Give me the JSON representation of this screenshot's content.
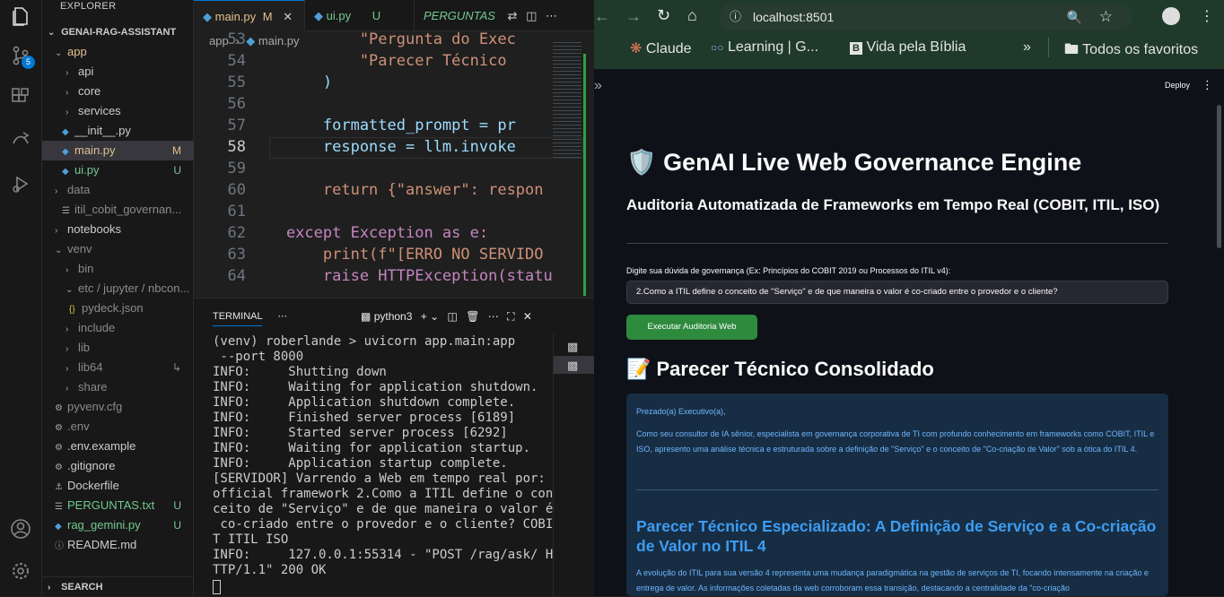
{
  "vscode": {
    "activity": {
      "source_control_badge": "5"
    },
    "explorer": {
      "header": "EXPLORER",
      "root": "GENAI-RAG-ASSISTANT",
      "items": [
        {
          "label": "app",
          "badge": ""
        },
        {
          "label": "api",
          "badge": ""
        },
        {
          "label": "core",
          "badge": ""
        },
        {
          "label": "services",
          "badge": ""
        },
        {
          "label": "__init__.py",
          "badge": ""
        },
        {
          "label": "main.py",
          "badge": "M"
        },
        {
          "label": "ui.py",
          "badge": "U"
        },
        {
          "label": "data",
          "badge": ""
        },
        {
          "label": "itil_cobit_governan...",
          "badge": ""
        },
        {
          "label": "notebooks",
          "badge": ""
        },
        {
          "label": "venv",
          "badge": ""
        },
        {
          "label": "bin",
          "badge": ""
        },
        {
          "label": "etc / jupyter / nbcon...",
          "badge": ""
        },
        {
          "label": "pydeck.json",
          "badge": ""
        },
        {
          "label": "include",
          "badge": ""
        },
        {
          "label": "lib",
          "badge": ""
        },
        {
          "label": "lib64",
          "badge": "↳"
        },
        {
          "label": "share",
          "badge": ""
        },
        {
          "label": "pyvenv.cfg",
          "badge": ""
        },
        {
          "label": ".env",
          "badge": ""
        },
        {
          "label": ".env.example",
          "badge": ""
        },
        {
          "label": ".gitignore",
          "badge": ""
        },
        {
          "label": "Dockerfile",
          "badge": ""
        },
        {
          "label": "PERGUNTAS.txt",
          "badge": "U"
        },
        {
          "label": "rag_gemini.py",
          "badge": "U"
        },
        {
          "label": "README.md",
          "badge": ""
        }
      ],
      "search_section": "SEARCH"
    },
    "tabs": [
      {
        "label": "main.py",
        "badge": "M"
      },
      {
        "label": "ui.py",
        "badge": "U"
      },
      {
        "label": "PERGUNTAS",
        "badge": ""
      }
    ],
    "breadcrumb": [
      "app",
      "main.py"
    ],
    "code": [
      {
        "n": "53",
        "text": "            \"Pergunta do Exec"
      },
      {
        "n": "54",
        "text": "            \"Parecer Técnico "
      },
      {
        "n": "55",
        "text": "        )"
      },
      {
        "n": "56",
        "text": ""
      },
      {
        "n": "57",
        "text": "        formatted_prompt = pr"
      },
      {
        "n": "58",
        "text": "        response = llm.invoke"
      },
      {
        "n": "59",
        "text": ""
      },
      {
        "n": "60",
        "text": "        return {\"answer\": respon"
      },
      {
        "n": "61",
        "text": ""
      },
      {
        "n": "62",
        "text": "    except Exception as e:"
      },
      {
        "n": "63",
        "text": "        print(f\"[ERRO NO SERVIDO"
      },
      {
        "n": "64",
        "text": "        raise HTTPException(statu"
      }
    ],
    "terminal": {
      "tab": "TERMINAL",
      "shell": "python3",
      "lines": [
        "(venv) roberlande > uvicorn app.main:app",
        " --port 8000",
        "INFO:     Shutting down",
        "INFO:     Waiting for application shutdown.",
        "INFO:     Application shutdown complete.",
        "INFO:     Finished server process [6189]",
        "INFO:     Started server process [6292]",
        "INFO:     Waiting for application startup.",
        "INFO:     Application startup complete.",
        "[SERVIDOR] Varrendo a Web em tempo real por:",
        "official framework 2.Como a ITIL define o con",
        "ceito de \"Serviço\" e de que maneira o valor é",
        " co-criado entre o provedor e o cliente? COBI",
        "T ITIL ISO",
        "INFO:     127.0.0.1:55314 - \"POST /rag/ask/ H",
        "TTP/1.1\" 200 OK"
      ]
    }
  },
  "browser": {
    "url": "localhost:8501",
    "bookmarks": [
      "Claude",
      "Learning | G...",
      "Vida pela Bíblia",
      "Todos os favoritos"
    ],
    "deploy": "Deploy",
    "title": "🛡️ GenAI Live Web Governance Engine",
    "subtitle": "Auditoria Automatizada de Frameworks em Tempo Real (COBIT, ITIL, ISO)",
    "input_label": "Digite sua dúvida de governança (Ex: Princípios do COBIT 2019 ou Processos do ITIL v4):",
    "input_value": "2.Como a ITIL define o conceito de \"Serviço\" e de que maneira o valor é co-criado entre o provedor e o cliente?",
    "button": "Executar Auditoria Web",
    "section_title": "📝 Parecer Técnico Consolidado",
    "result": {
      "greeting": "Prezado(a) Executivo(a),",
      "intro": "Como seu consultor de IA sênior, especialista em governança corporativa de TI com profundo conhecimento em frameworks como COBIT, ITIL e ISO, apresento uma análise técnica e estruturada sobre a definição de \"Serviço\" e o conceito de \"Co-criação de Valor\" sob a ótica do ITIL 4.",
      "heading": "Parecer Técnico Especializado: A Definição de Serviço e a Co-criação de Valor no ITIL 4",
      "body": "A evolução do ITIL para sua versão 4 representa uma mudança paradigmática na gestão de serviços de TI, focando intensamente na criação e entrega de valor. As informações coletadas da web corroboram essa transição, destacando a centralidade da \"co-criação"
    },
    "accent_color": "#2e8b3d"
  }
}
